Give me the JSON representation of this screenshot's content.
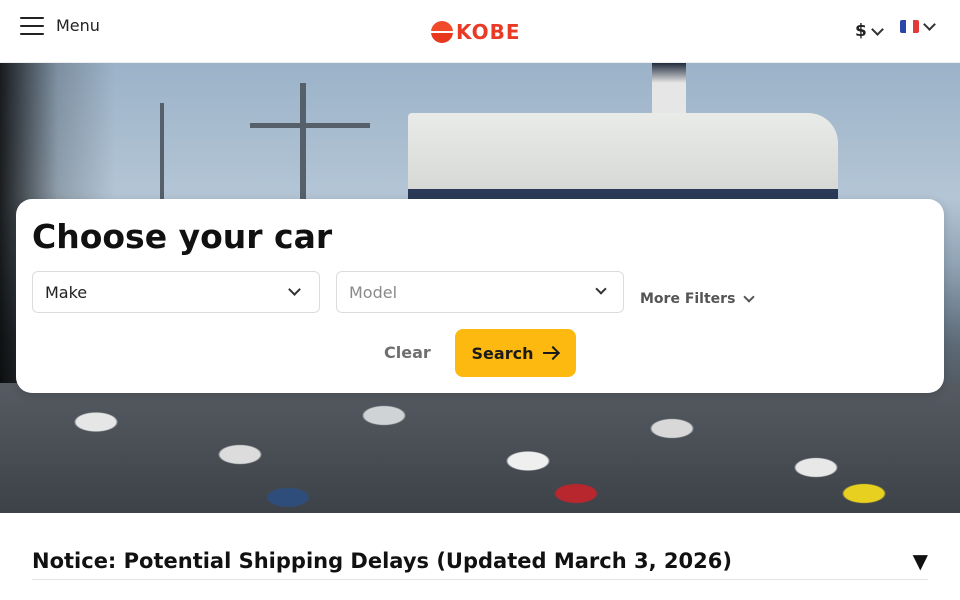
{
  "header": {
    "menu_label": "Menu",
    "logo_text": "KOBE",
    "currency_symbol": "$",
    "language_flag": "flag-fr-icon"
  },
  "search": {
    "title": "Choose your car",
    "make": {
      "value": "Make"
    },
    "model": {
      "placeholder": "Model"
    },
    "more_filters_label": "More Filters",
    "clear_label": "Clear",
    "search_label": "Search"
  },
  "notice": {
    "text": "Notice: Potential Shipping Delays (Updated March 3, 2026)",
    "toggle_icon": "▼"
  },
  "colors": {
    "accent": "#fdb90f",
    "brand": "#e83a24"
  }
}
